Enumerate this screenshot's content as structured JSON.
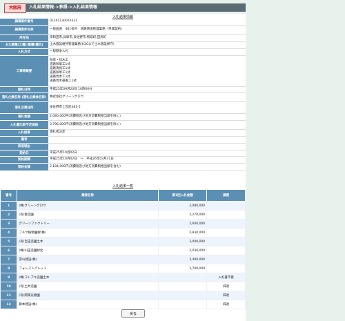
{
  "header": {
    "prefecture": "大阪府",
    "breadcrumb": "入札結果情報->参照->入札結果情報"
  },
  "info_title": "入札結果情報",
  "info_rows": [
    {
      "label": "調達案件番号",
      "lines": [
        "01201130010331"
      ]
    },
    {
      "label": "調達案件名称",
      "lines": [
        "一般国道　481号外　道路環境管理業務（単価契約）"
      ]
    },
    {
      "label": "所在地",
      "lines": [
        "岸和田市,貝塚市,泉佐野市,熊取町,田尻町"
      ]
    },
    {
      "label": "主な業種(工種)/業種(種目)",
      "lines": [
        "土木施設維持管理業務(H20まで土木施設保守)"
      ]
    },
    {
      "label": "入札方式",
      "lines": [
        "一般競争入札"
      ]
    },
    {
      "label": "工事等概要",
      "lines": [
        "除草・伐木工",
        "道路除草工1式",
        "道路清掃工1式",
        "道路除草工1式",
        "道路伐木工1式",
        "道路伐木運搬工1式"
      ]
    },
    {
      "label": "開札日時",
      "lines": [
        "平成25年09月20日 10時00分"
      ]
    },
    {
      "label": "落札企業名称\n(落札企業体名称)",
      "lines": [
        "株式会社グリーングロウ"
      ]
    },
    {
      "label": "落札企業住所",
      "lines": [
        "",
        "泉佐野市上瓦屋481-5"
      ]
    },
    {
      "label": "落札金額",
      "lines": [
        "2,080,000円(消費税及び地方消費税相当額を除く)"
      ]
    },
    {
      "label": "入札書比較予定価格",
      "lines": [
        "3,796,000円(消費税及び地方消費税相当額を除く)"
      ]
    },
    {
      "label": "入札結果",
      "lines": [
        "落札者決定"
      ]
    },
    {
      "label": "備考",
      "lines": [
        ""
      ]
    },
    {
      "label": "辞退理由",
      "lines": [
        ""
      ]
    },
    {
      "label": "契約日",
      "lines": [
        "平成25年10月02日"
      ]
    },
    {
      "label": "契約期間",
      "lines": [
        "平成25年10月02日　～　平成26年03月31日"
      ]
    },
    {
      "label": "契約金額",
      "lines": [
        "2,184,000円(消費税及び地方消費税相当額を含む)"
      ]
    }
  ],
  "bids_title": "入札結果一覧",
  "bids_headers": {
    "no": "番号",
    "name": "業者名称",
    "amount": "第1回入札金額",
    "remark": "摘要"
  },
  "bids": [
    {
      "no": "1",
      "name": "(株)グリーングロウ",
      "amount": "2,080,000",
      "remark": ""
    },
    {
      "no": "2",
      "name": "(有)秦造園",
      "amount": "2,270,000",
      "remark": ""
    },
    {
      "no": "3",
      "name": "グリーンファクトリー",
      "amount": "2,600,000",
      "remark": ""
    },
    {
      "no": "4",
      "name": "フルヤ植物園緑(株)",
      "amount": "2,830,000",
      "remark": ""
    },
    {
      "no": "5",
      "name": "(有)吉田造園土木",
      "amount": "3,000,000",
      "remark": ""
    },
    {
      "no": "6",
      "name": "(株)山田造園緑化",
      "amount": "3,036,000",
      "remark": ""
    },
    {
      "no": "7",
      "name": "雪山建設(株)",
      "amount": "3,400,000",
      "remark": ""
    },
    {
      "no": "8",
      "name": "フォレストパレット",
      "amount": "3,700,000",
      "remark": ""
    },
    {
      "no": "9",
      "name": "(株)コトブキ造園土木",
      "amount": "",
      "remark": "入札書不着"
    },
    {
      "no": "10",
      "name": "(有)土井造園",
      "amount": "",
      "remark": "辞退"
    },
    {
      "no": "11",
      "name": "(有)関東光樹園",
      "amount": "",
      "remark": "辞退"
    },
    {
      "no": "12",
      "name": "藤本建設(株)",
      "amount": "",
      "remark": "辞退"
    }
  ],
  "back_label": "戻る"
}
